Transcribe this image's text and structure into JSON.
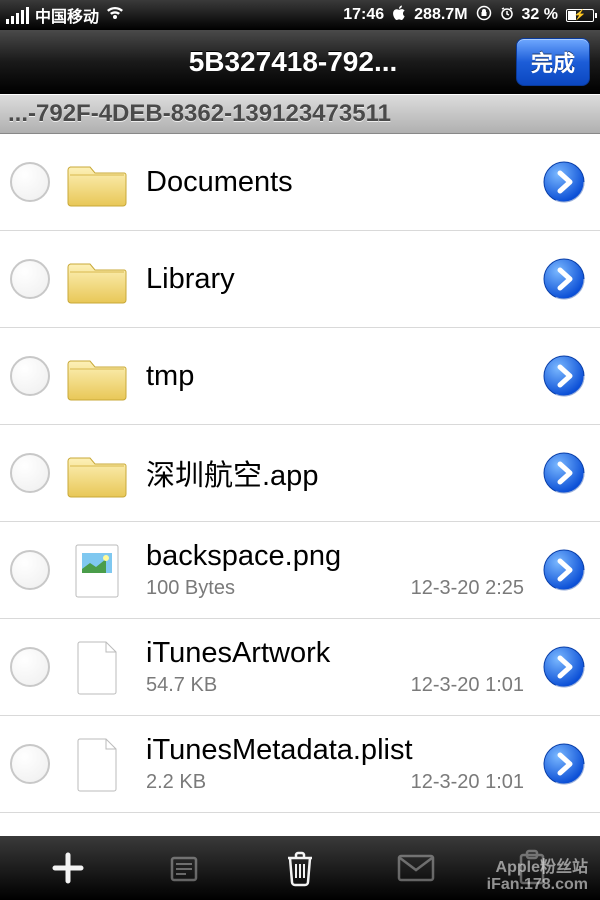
{
  "status": {
    "carrier": "中国移动",
    "time": "17:46",
    "mem": "288.7M",
    "battery_pct": "32 %"
  },
  "nav": {
    "title": "5B327418-792...",
    "done": "完成"
  },
  "path": "...-792F-4DEB-8362-139123473511",
  "rows": [
    {
      "name": "Documents",
      "type": "folder",
      "size": "",
      "date": ""
    },
    {
      "name": "Library",
      "type": "folder",
      "size": "",
      "date": ""
    },
    {
      "name": "tmp",
      "type": "folder",
      "size": "",
      "date": ""
    },
    {
      "name": "深圳航空.app",
      "type": "folder",
      "size": "",
      "date": ""
    },
    {
      "name": "backspace.png",
      "type": "image",
      "size": "100 Bytes",
      "date": "12-3-20 2:25"
    },
    {
      "name": "iTunesArtwork",
      "type": "file",
      "size": "54.7 KB",
      "date": "12-3-20 1:01"
    },
    {
      "name": "iTunesMetadata.plist",
      "type": "file",
      "size": "2.2 KB",
      "date": "12-3-20 1:01"
    }
  ],
  "watermark": {
    "line1": "Apple粉丝站",
    "line2": "iFan.178.com"
  }
}
